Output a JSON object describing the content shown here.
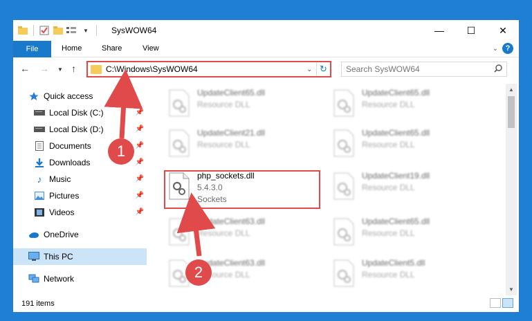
{
  "window": {
    "title": "SysWOW64",
    "controls": {
      "minimize": "—",
      "maximize": "☐",
      "close": "✕"
    }
  },
  "ribbon": {
    "file": "File",
    "tabs": [
      "Home",
      "Share",
      "View"
    ]
  },
  "address": {
    "path": "C:\\Windows\\SysWOW64"
  },
  "search": {
    "placeholder": "Search SysWOW64"
  },
  "sidebar": {
    "items": [
      {
        "label": "Quick access",
        "icon": "star-icon"
      },
      {
        "label": "Local Disk (C:)",
        "icon": "drive-icon",
        "pinned": true
      },
      {
        "label": "Local Disk (D:)",
        "icon": "drive-icon",
        "pinned": true
      },
      {
        "label": "Documents",
        "icon": "documents-icon",
        "pinned": true
      },
      {
        "label": "Downloads",
        "icon": "downloads-icon",
        "pinned": true
      },
      {
        "label": "Music",
        "icon": "music-icon",
        "pinned": true
      },
      {
        "label": "Pictures",
        "icon": "pictures-icon",
        "pinned": true
      },
      {
        "label": "Videos",
        "icon": "videos-icon",
        "pinned": true
      },
      {
        "label": "OneDrive",
        "icon": "cloud-icon"
      },
      {
        "label": "This PC",
        "icon": "computer-icon",
        "selected": true
      },
      {
        "label": "Network",
        "icon": "network-icon"
      }
    ]
  },
  "files": {
    "left": [
      {
        "name": "UpdateClient65.dll",
        "sub1": "Resource DLL",
        "sub2": ""
      },
      {
        "name": "UpdateClient21.dll",
        "sub1": "Resource DLL",
        "sub2": ""
      },
      {
        "name": "php_sockets.dll",
        "sub1": "5.4.3.0",
        "sub2": "Sockets"
      },
      {
        "name": "UpdateClient63.dll",
        "sub1": "Resource DLL",
        "sub2": ""
      },
      {
        "name": "UpdateClient63.dll",
        "sub1": "Resource DLL",
        "sub2": ""
      }
    ],
    "right": [
      {
        "name": "UpdateClient65.dll",
        "sub1": "Resource DLL"
      },
      {
        "name": "UpdateClient65.dll",
        "sub1": "Resource DLL"
      },
      {
        "name": "UpdateClient19.dll",
        "sub1": "Resource DLL"
      },
      {
        "name": "UpdateClient65.dll",
        "sub1": "Resource DLL"
      },
      {
        "name": "UpdateClient5.dll",
        "sub1": "Resource DLL"
      }
    ]
  },
  "status": {
    "count": "191 items"
  },
  "callouts": [
    "1",
    "2"
  ],
  "colors": {
    "accent": "#1979ca",
    "highlight": "#e04a4a",
    "desktop": "#1f7fd4"
  }
}
